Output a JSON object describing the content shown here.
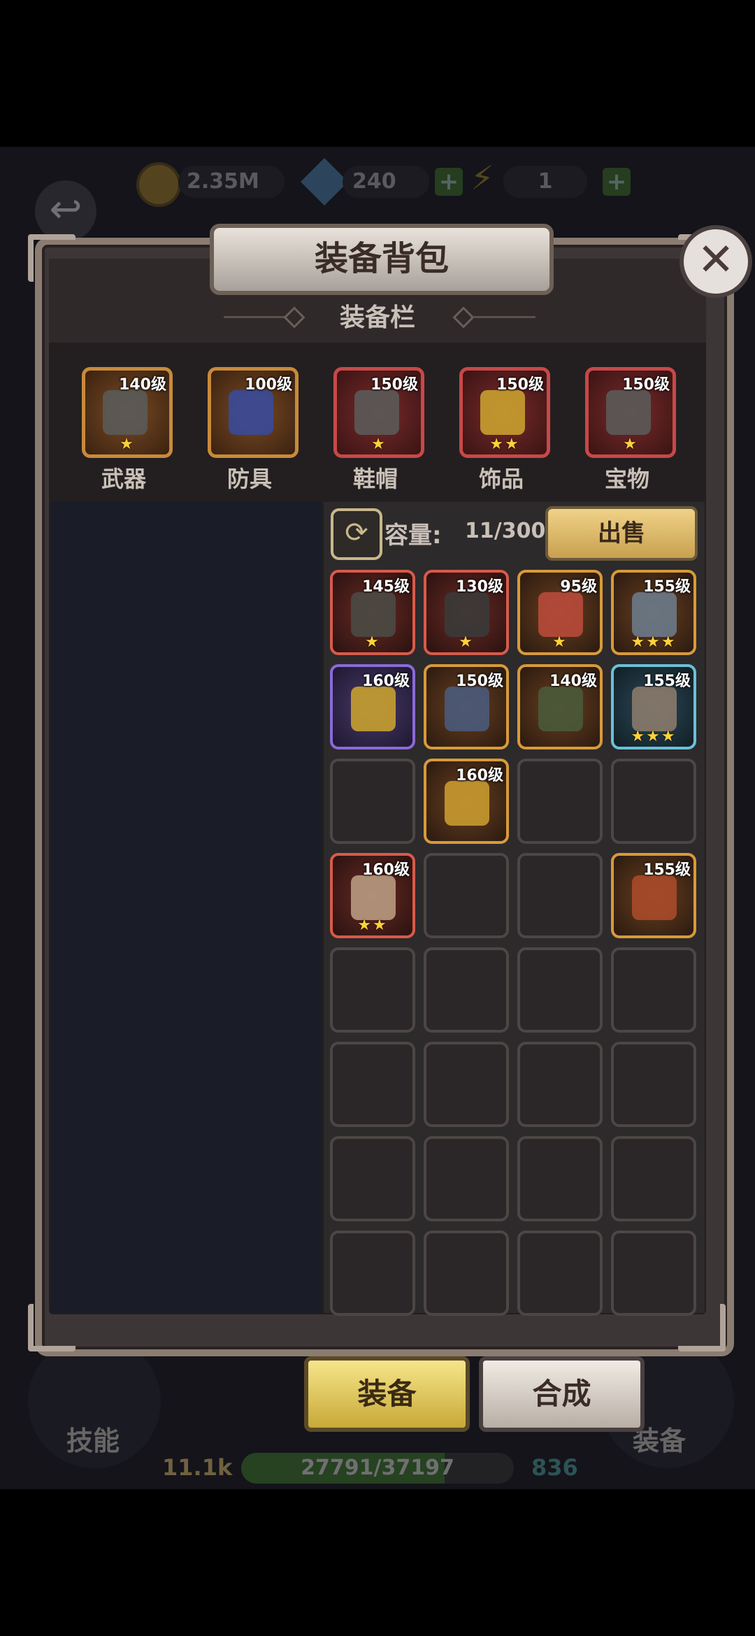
{
  "resources": {
    "gold": "2.35M",
    "gems": "240",
    "energy": "1"
  },
  "panel": {
    "title": "装备背包",
    "close_icon": "close-icon",
    "equip_section_title": "装备栏"
  },
  "equipped": [
    {
      "level": "140级",
      "label": "武器",
      "stars": "★",
      "icon": "gauntlet-icon",
      "color": "#c88a3a"
    },
    {
      "level": "100级",
      "label": "防具",
      "stars": "",
      "icon": "armor-icon",
      "color": "#c88a3a"
    },
    {
      "level": "150级",
      "label": "鞋帽",
      "stars": "★",
      "icon": "hood-icon",
      "color": "#c84848"
    },
    {
      "level": "150级",
      "label": "饰品",
      "stars": "★★",
      "icon": "necklace-icon",
      "color": "#c84848"
    },
    {
      "level": "150级",
      "label": "宝物",
      "stars": "★",
      "icon": "relic-icon",
      "color": "#c84848"
    }
  ],
  "inventory": {
    "capacity_label": "容量:",
    "capacity_value": "11/300",
    "sell_label": "出售",
    "items": [
      {
        "level": "145级",
        "stars": "★",
        "rarity": "red",
        "icon": "rifle-icon"
      },
      {
        "level": "130级",
        "stars": "★",
        "rarity": "red",
        "icon": "hood-icon"
      },
      {
        "level": "95级",
        "stars": "★",
        "rarity": "gold",
        "icon": "helmet-icon"
      },
      {
        "level": "155级",
        "stars": "★★★",
        "rarity": "gold",
        "icon": "spear-icon"
      },
      {
        "level": "160级",
        "stars": "",
        "rarity": "purple",
        "icon": "ring-icon"
      },
      {
        "level": "150级",
        "stars": "",
        "rarity": "gold",
        "icon": "crossbow-icon"
      },
      {
        "level": "140级",
        "stars": "",
        "rarity": "gold",
        "icon": "boots-icon"
      },
      {
        "level": "155级",
        "stars": "★★★",
        "rarity": "blue",
        "icon": "pistol-icon"
      },
      {
        "level": "",
        "stars": "",
        "rarity": "empty",
        "icon": ""
      },
      {
        "level": "160级",
        "stars": "",
        "rarity": "gold",
        "icon": "raygun-icon"
      },
      {
        "level": "",
        "stars": "",
        "rarity": "empty",
        "icon": ""
      },
      {
        "level": "",
        "stars": "",
        "rarity": "empty",
        "icon": ""
      },
      {
        "level": "160级",
        "stars": "★★",
        "rarity": "red",
        "icon": "cones-icon"
      },
      {
        "level": "",
        "stars": "",
        "rarity": "empty",
        "icon": ""
      },
      {
        "level": "",
        "stars": "",
        "rarity": "empty",
        "icon": ""
      },
      {
        "level": "155级",
        "stars": "",
        "rarity": "gold",
        "icon": "cannon-icon"
      }
    ]
  },
  "tabs": {
    "equip": "装备",
    "synth": "合成"
  },
  "bottom_bar": {
    "skill_label": "技能",
    "equip_label": "装备",
    "power": "11.1k",
    "progress": "27791/37197",
    "progress_fraction": 0.747,
    "right_value": "836"
  }
}
